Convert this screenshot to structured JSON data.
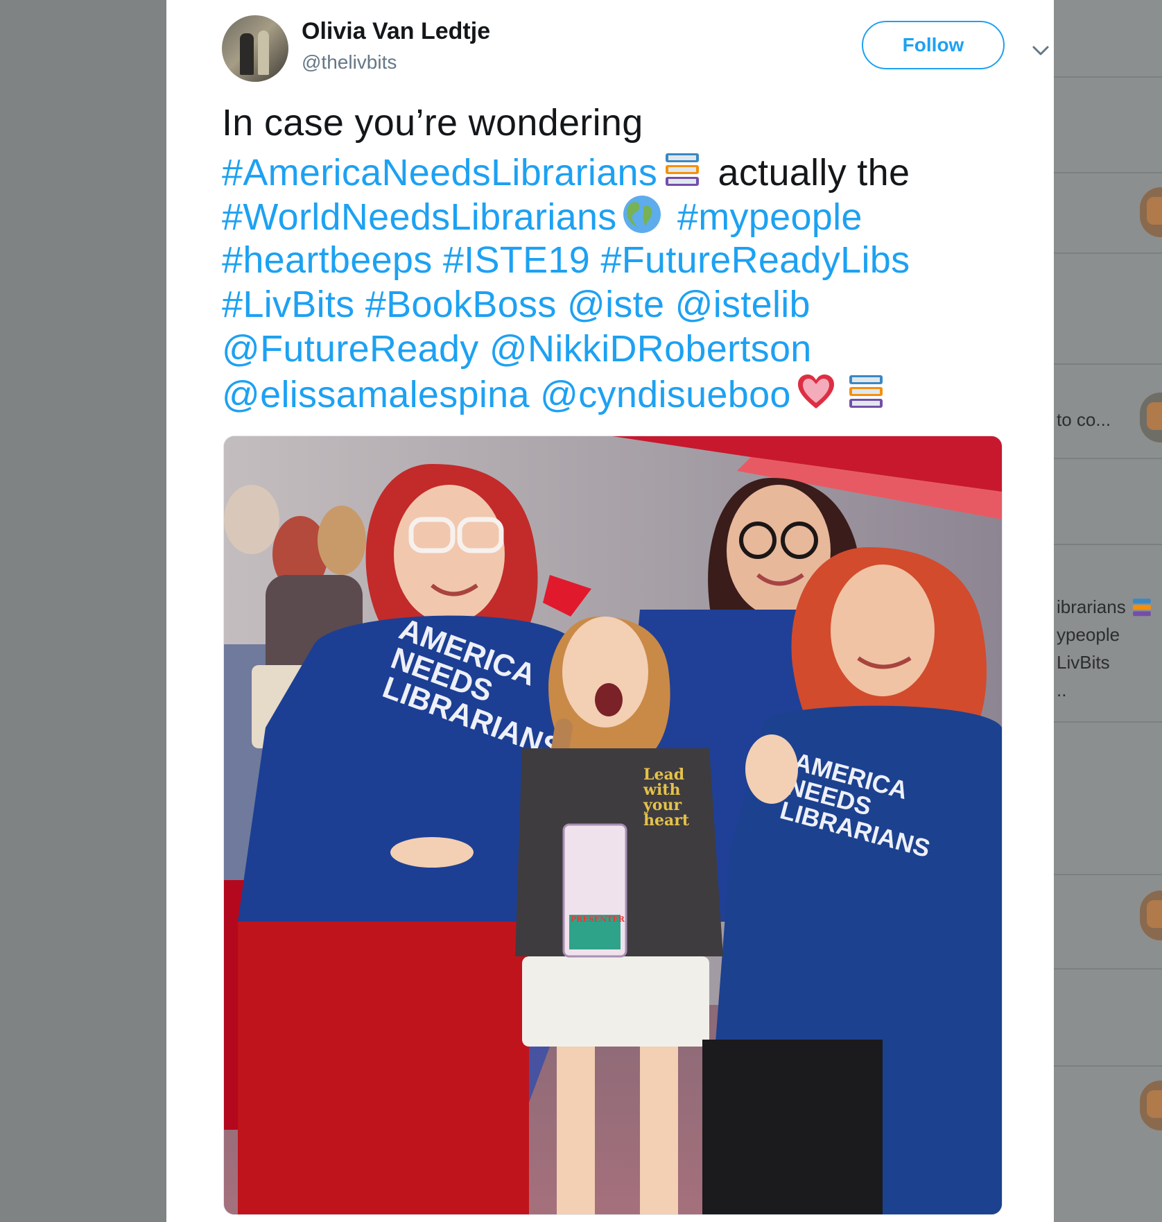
{
  "tweet": {
    "author": {
      "display_name": "Olivia Van Ledtje",
      "handle": "@thelivbits"
    },
    "follow_label": "Follow",
    "text_lines": [
      [
        {
          "t": "In case you’re wondering",
          "tag": false
        }
      ],
      [
        {
          "t": "#AmericaNeedsLibrarians",
          "tag": true
        },
        {
          "emoji": "books"
        },
        {
          "t": " actually the",
          "tag": false
        }
      ],
      [
        {
          "t": "#WorldNeedsLibrarians",
          "tag": true
        },
        {
          "emoji": "globe"
        },
        {
          "t": " #mypeople",
          "tag": true
        }
      ],
      [
        {
          "t": "#heartbeeps #ISTE19 #FutureReadyLibs",
          "tag": true
        }
      ],
      [
        {
          "t": "#LivBits #BookBoss  @iste @istelib",
          "tag": true
        }
      ],
      [
        {
          "t": "@FutureReady @NikkiDRobertson",
          "tag": true
        }
      ],
      [
        {
          "t": "@elissamalespina @cyndisueboo",
          "tag": true
        },
        {
          "emoji": "heart"
        },
        {
          "emoji": "books"
        }
      ]
    ],
    "photo": {
      "shirt_text": [
        "AMERICA",
        "NEEDS",
        "LIBRARIANS"
      ],
      "child_shirt_text": [
        "Lead",
        "with",
        "your",
        "heart"
      ],
      "badge_text": "PRESENTER"
    }
  },
  "background_timeline": {
    "snippets": [
      "to co...",
      "ibrarians",
      "ypeople",
      "LivBits",
      ".."
    ]
  },
  "colors": {
    "link": "#1da1f2",
    "text": "#14171a",
    "secondary": "#657786",
    "overlay": "#7f8384"
  },
  "icons": {
    "caret": "chevron-down-icon",
    "books": "books-emoji",
    "globe": "globe-americas-emoji",
    "heart": "heart-emoji"
  }
}
